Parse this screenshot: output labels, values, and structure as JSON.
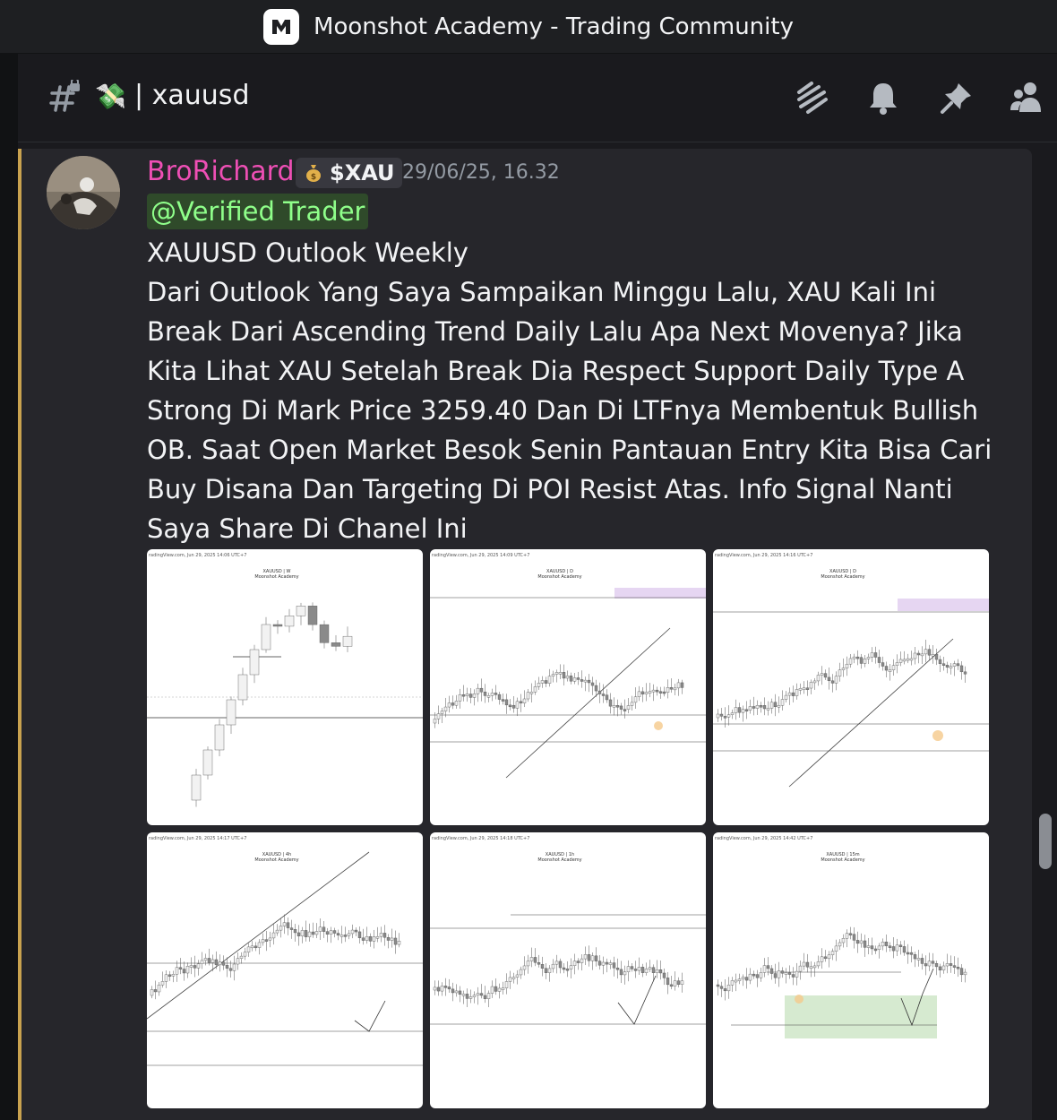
{
  "window": {
    "title": "Moonshot Academy - Trading Community"
  },
  "channel": {
    "emoji": "💸",
    "name": "| xauusd"
  },
  "message": {
    "author": "BroRichard",
    "tag_label": "$XAU",
    "timestamp": "29/06/25, 16.32",
    "mention": "@Verified Trader",
    "lines": [
      "XAUUSD Outlook Weekly",
      "Dari Outlook Yang Saya Sampaikan Minggu Lalu, XAU Kali Ini Break Dari Ascending Trend Daily Lalu Apa Next Movenya? Jika Kita Lihat XAU Setelah Break Dia Respect Support Daily Type A Strong Di Mark Price 3259.40 Dan Di LTFnya Membentuk Bullish OB. Saat Open Market Besok Senin Pantauan Entry Kita Bisa Cari Buy Disana Dan Targeting Di POI Resist Atas. Info Signal Nanti Saya Share Di Chanel Ini"
    ],
    "attachments": [
      {
        "header": "radingView.com, Jun 29, 2025 14:06 UTC+7",
        "title": "XAUUSD | W",
        "subtitle": "Moonshot Academy"
      },
      {
        "header": "radingView.com, Jun 29, 2025 14:09 UTC+7",
        "title": "XAUUSD | D",
        "subtitle": "Moonshot Academy"
      },
      {
        "header": "radingView.com, Jun 29, 2025 14:16 UTC+7",
        "title": "XAUUSD | D",
        "subtitle": "Moonshot Academy"
      },
      {
        "header": "radingView.com, Jun 29, 2025 14:17 UTC+7",
        "title": "XAUUSD | 4h",
        "subtitle": "Moonshot Academy"
      },
      {
        "header": "radingView.com, Jun 29, 2025 14:18 UTC+7",
        "title": "XAUUSD | 1h",
        "subtitle": "Moonshot Academy"
      },
      {
        "header": "radingView.com, Jun 29, 2025 14:42 UTC+7",
        "title": "XAUUSD | 15m",
        "subtitle": "Moonshot Academy"
      }
    ]
  },
  "colors": {
    "author": "#ee4fb5",
    "mention": "#8fff8a",
    "accent_border": "#c9a24f"
  },
  "icons": {
    "channel": "hashtag-lock-icon",
    "threads": "threads-icon",
    "notifications": "bell-icon",
    "pins": "pin-icon",
    "members": "members-icon"
  }
}
